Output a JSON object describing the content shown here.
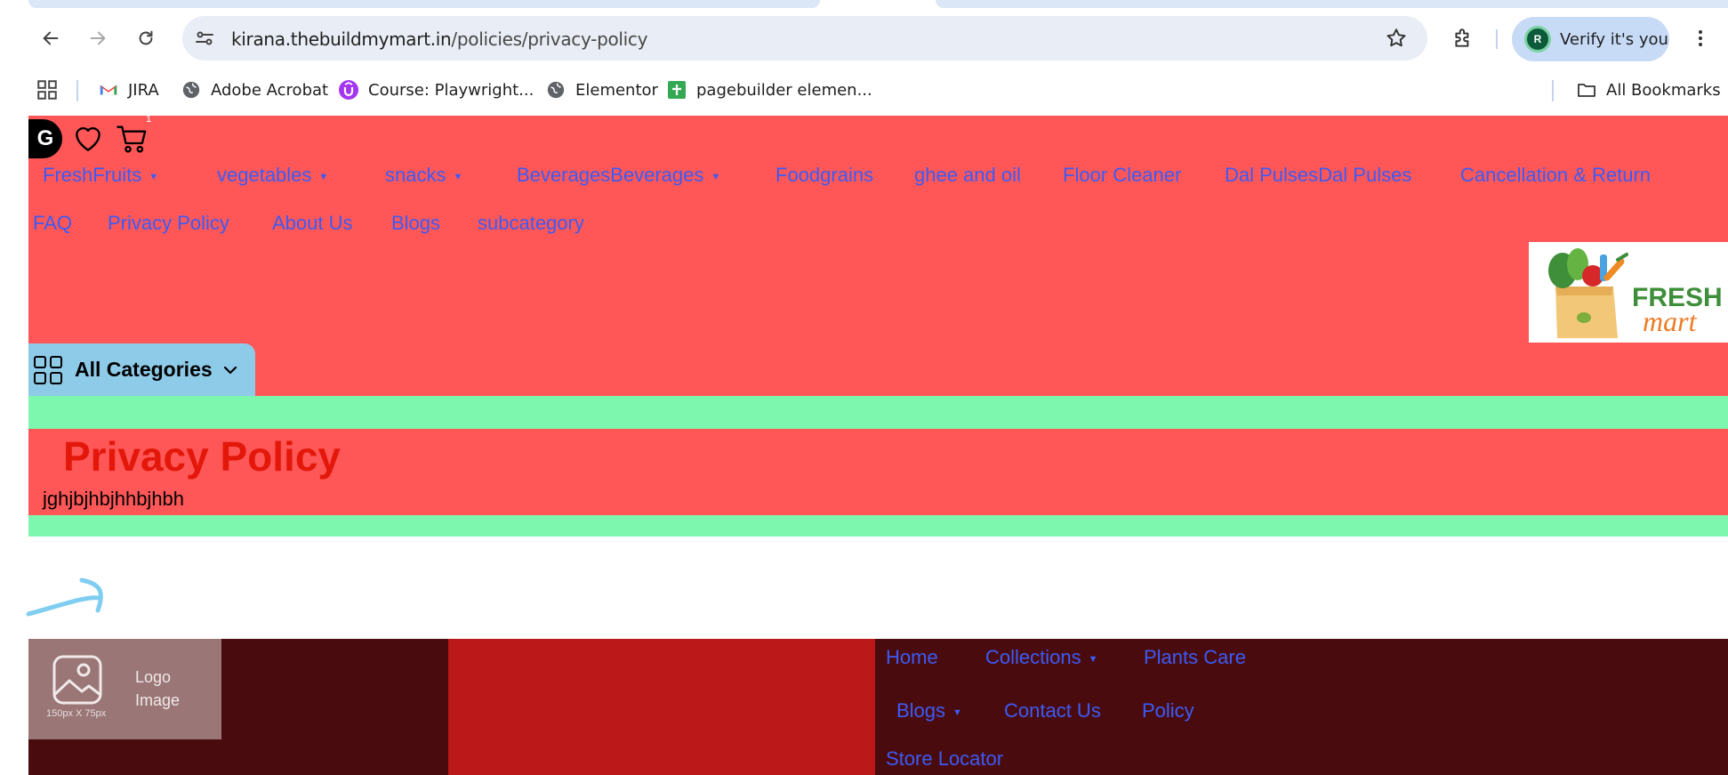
{
  "browser": {
    "url_host": "kirana.thebuildmymart.in",
    "url_path": "/policies/privacy-policy",
    "profile_label": "Verify it's you",
    "profile_initial": "R",
    "bookmarks": [
      {
        "label": "JIRA",
        "icon": "gmail-icon"
      },
      {
        "label": "Adobe Acrobat",
        "icon": "globe-icon"
      },
      {
        "label": "Course: Playwright...",
        "icon": "udemy-icon"
      },
      {
        "label": "Elementor",
        "icon": "globe-icon"
      },
      {
        "label": "pagebuilder elemen...",
        "icon": "sheets-icon"
      }
    ],
    "all_bookmarks_label": "All Bookmarks"
  },
  "header": {
    "logo_letter": "G",
    "cart_count": "1",
    "nav_row1": [
      {
        "label": "FreshFruits",
        "dropdown": true
      },
      {
        "label": "vegetables",
        "dropdown": true
      },
      {
        "label": "snacks",
        "dropdown": true
      },
      {
        "label": "BeveragesBeverages",
        "dropdown": true
      },
      {
        "label": "Foodgrains",
        "dropdown": false
      },
      {
        "label": "ghee and oil",
        "dropdown": false
      },
      {
        "label": "Floor Cleaner",
        "dropdown": false
      },
      {
        "label": "Dal PulsesDal Pulses",
        "dropdown": false
      },
      {
        "label": "Cancellation & Return",
        "dropdown": false
      }
    ],
    "nav_row2": [
      {
        "label": "FAQ"
      },
      {
        "label": "Privacy Policy"
      },
      {
        "label": "About Us"
      },
      {
        "label": "Blogs"
      },
      {
        "label": "subcategory"
      }
    ],
    "brand_fresh": "FRESH",
    "brand_mart": "mart",
    "categories_label": "All Categories"
  },
  "content": {
    "title": "Privacy Policy",
    "body": "jghjbjhbjhhbjhbh"
  },
  "footer": {
    "logo_text": "Logo Image",
    "logo_dims": "150px X 75px",
    "links": [
      {
        "label": "Home",
        "dropdown": false
      },
      {
        "label": "Collections",
        "dropdown": true
      },
      {
        "label": "Plants Care",
        "dropdown": false
      },
      {
        "label": "Blogs",
        "dropdown": true
      },
      {
        "label": "Contact Us",
        "dropdown": false
      },
      {
        "label": "Policy",
        "dropdown": false
      },
      {
        "label": "Store Locator",
        "dropdown": false
      }
    ]
  },
  "colors": {
    "header_bg": "#ff5757",
    "link": "#3b5bf5",
    "green_bar": "#7df7ad",
    "footer_bg": "#4a0b0e",
    "footer_mid": "#bb1919",
    "title_red": "#e3170a"
  }
}
